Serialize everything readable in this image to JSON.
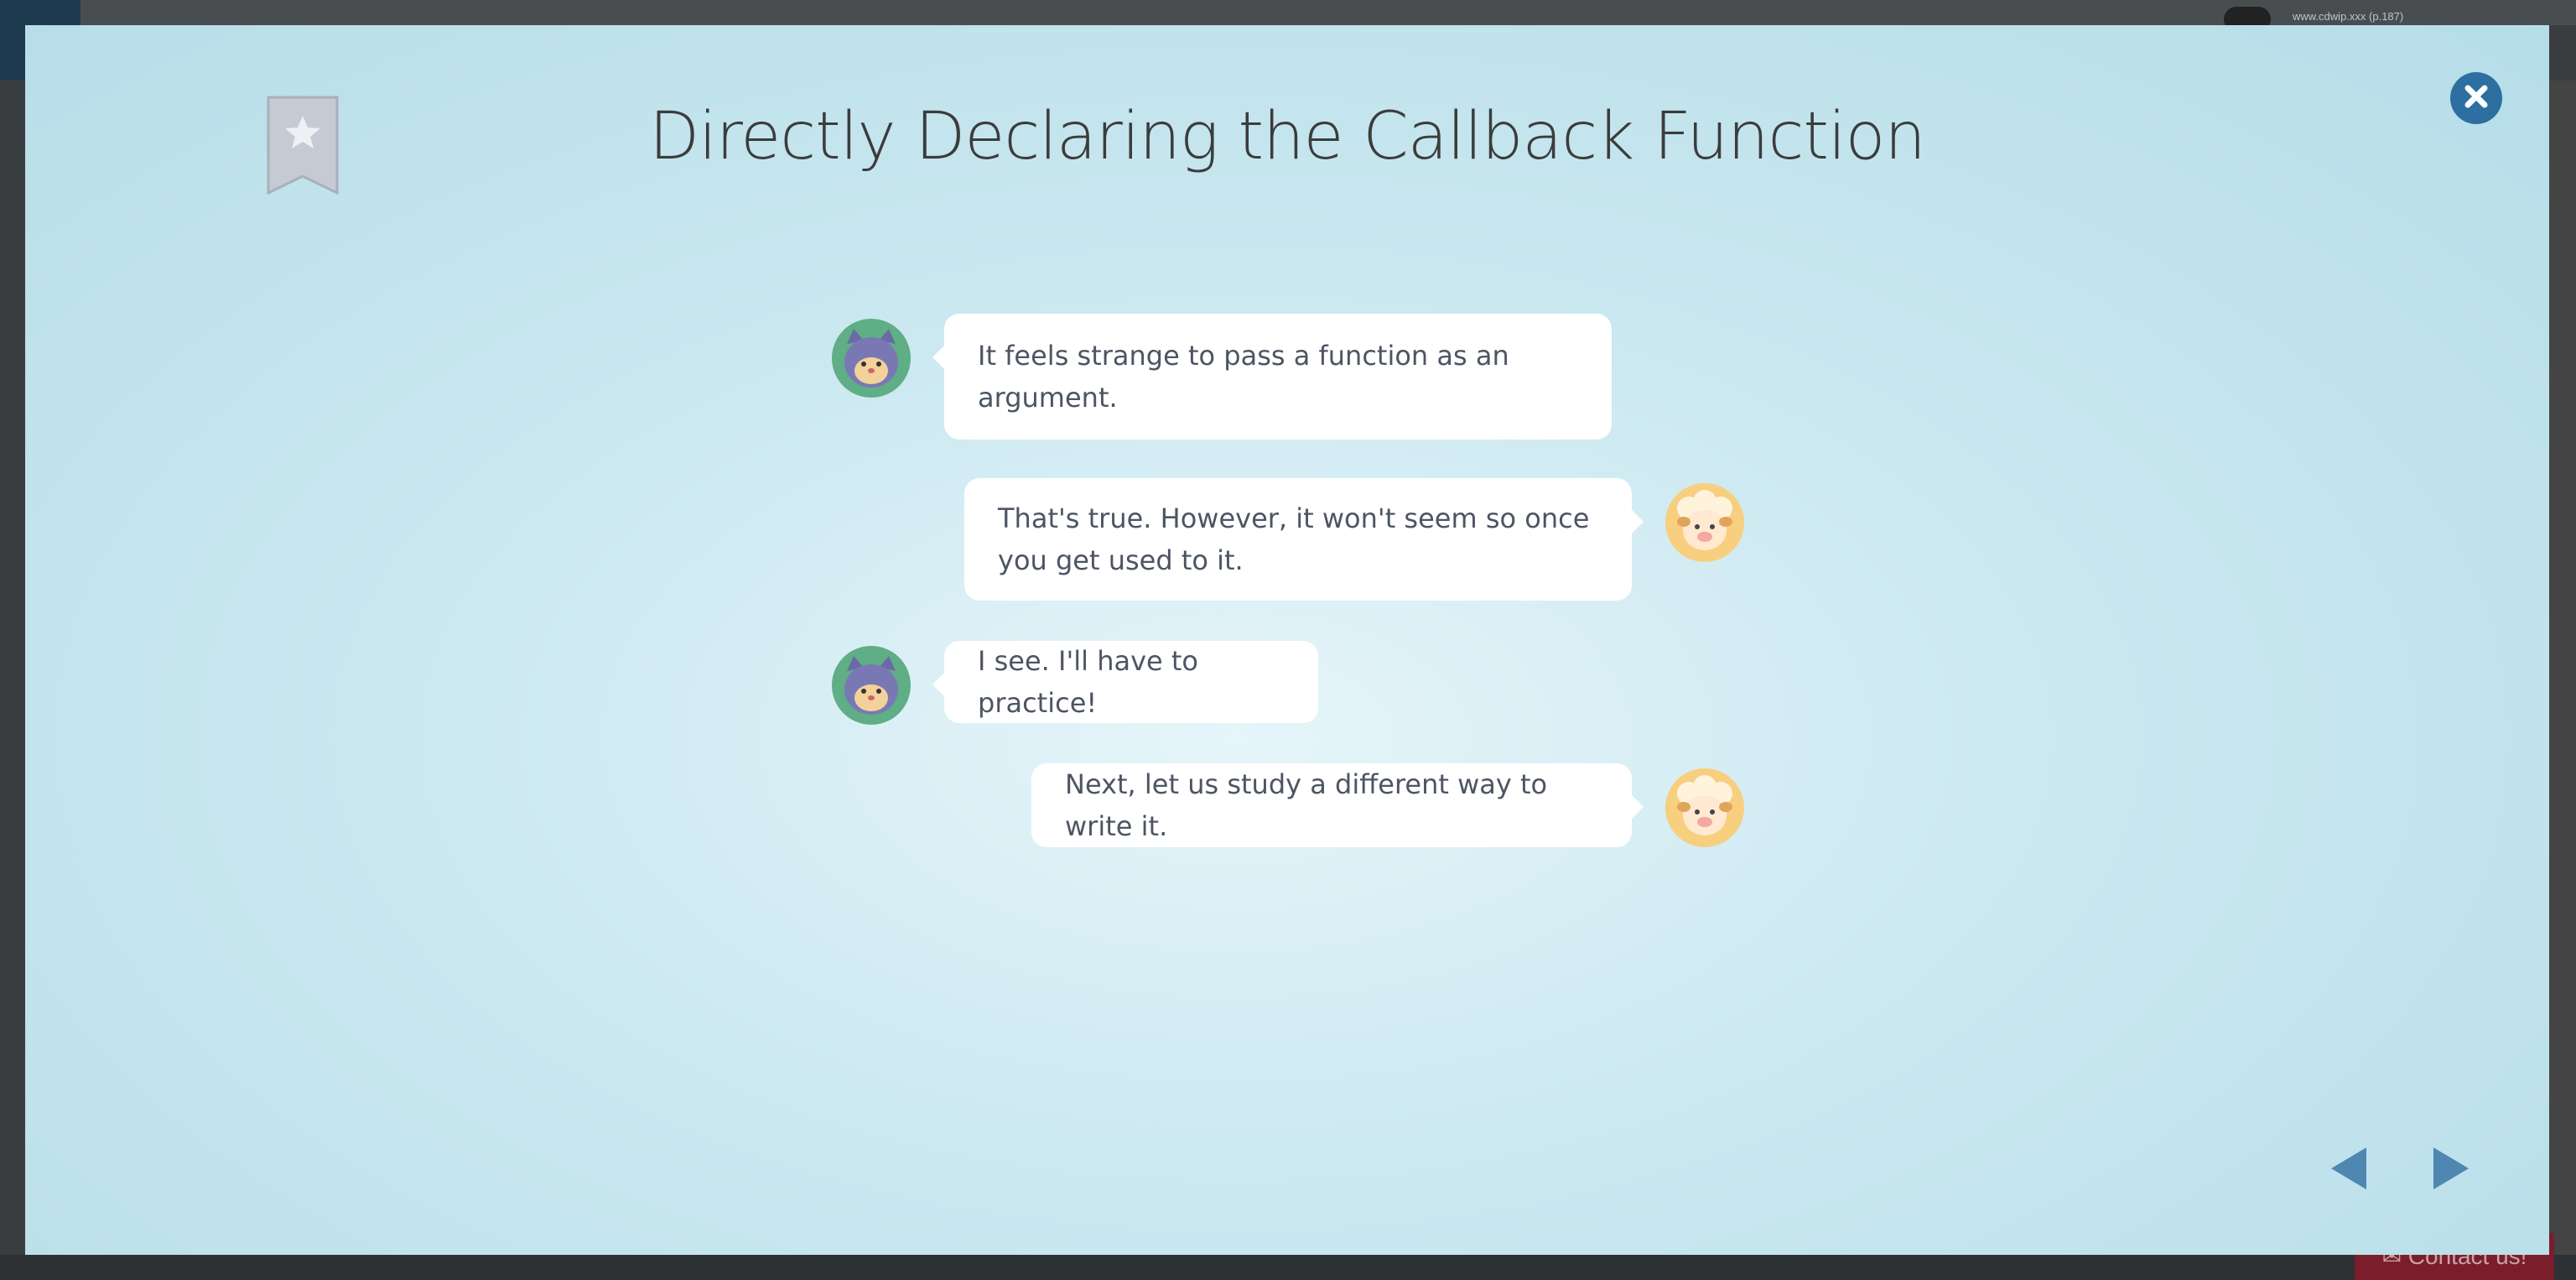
{
  "background": {
    "url_text": "www.cdwip.xxx (p.187)",
    "contact_label": "✉ Contact us!"
  },
  "modal": {
    "title": "Directly Declaring the Callback Function",
    "close_icon": "close-icon",
    "bookmark_icon": "star-bookmark-icon",
    "accent_color": "#2c6fa0",
    "messages": [
      {
        "speaker": "cat",
        "side": "left",
        "text": "It feels strange to pass a function as an argument."
      },
      {
        "speaker": "sheep",
        "side": "right",
        "text": "That's true. However, it won't seem so once you get used to it."
      },
      {
        "speaker": "cat",
        "side": "left",
        "text": "I see. I'll have to practice!"
      },
      {
        "speaker": "sheep",
        "side": "right",
        "text": "Next, let us study a different way to write it."
      }
    ],
    "nav": {
      "prev_icon": "triangle-left-icon",
      "next_icon": "triangle-right-icon"
    }
  }
}
